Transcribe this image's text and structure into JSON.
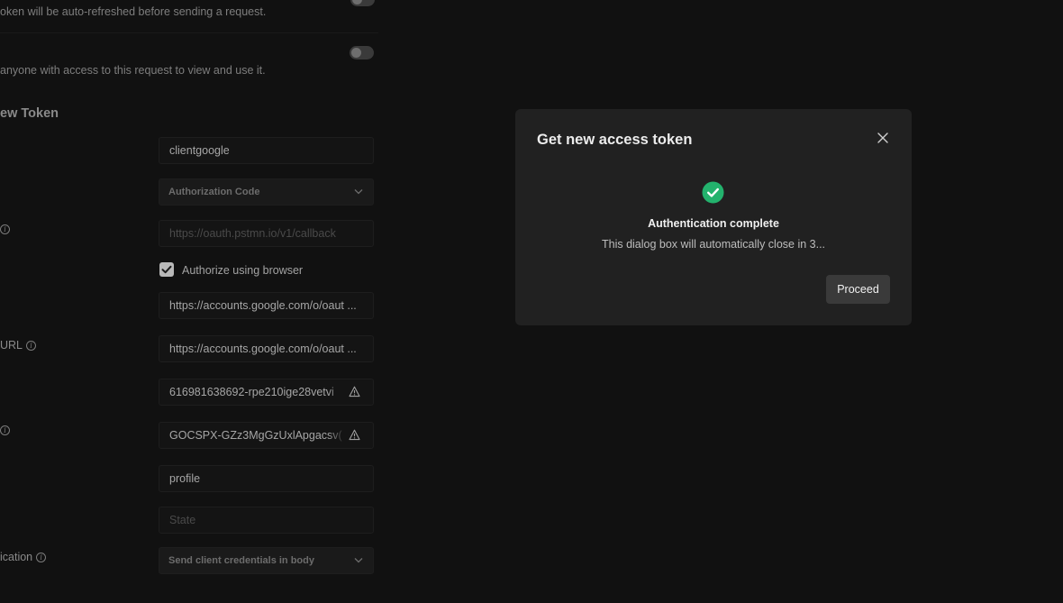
{
  "background": {
    "auto_refresh_note": "oken will be auto-refreshed before sending a request.",
    "share_note": "anyone with access to this request to view and use it.",
    "section_title": "ew Token",
    "fields": {
      "token_name": "clientgoogle",
      "grant_type": "Authorization Code",
      "callback_url_placeholder": "https://oauth.pstmn.io/v1/callback",
      "authorize_browser_label": "Authorize using browser",
      "auth_url": "https://accounts.google.com/o/oaut ...",
      "access_token_url": "https://accounts.google.com/o/oaut ...",
      "client_id": "616981638692-rpe210ige28vetvi",
      "client_secret": "GOCSPX-GZz3MgGzUxlApgacsv(",
      "scope": "profile",
      "state_placeholder": "State",
      "client_authentication": "Send client credentials in body"
    },
    "labels": {
      "access_token_url_label": "URL",
      "client_auth_label": "ication"
    },
    "authorize_browser_checked": true,
    "toggles": {
      "auto_refresh": false,
      "share_token": false
    }
  },
  "modal": {
    "title": "Get new access token",
    "status_title": "Authentication complete",
    "status_message": "This dialog box will automatically close in 3...",
    "proceed_label": "Proceed"
  },
  "colors": {
    "success": "#23b26d",
    "modal_bg": "#212121",
    "page_bg": "#111111"
  },
  "icons": {
    "close": "close-icon",
    "success": "check-circle-icon",
    "info": "info-icon",
    "warning": "warning-icon",
    "chevron": "chevron-down-icon",
    "checkbox": "check-icon"
  }
}
